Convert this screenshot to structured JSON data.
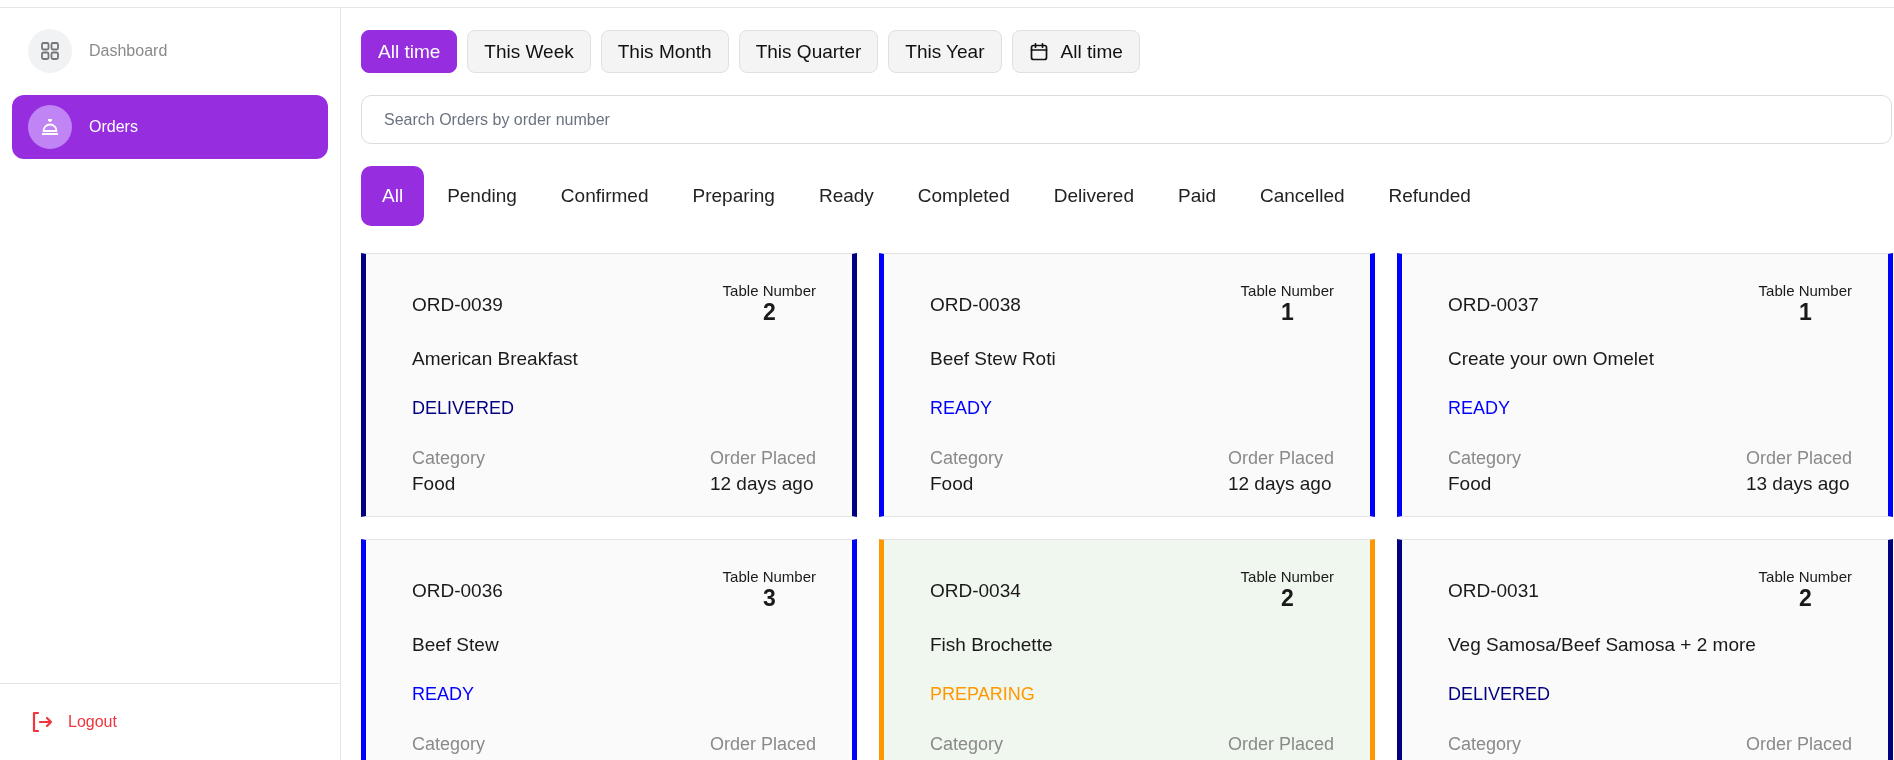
{
  "sidebar": {
    "items": [
      {
        "label": "Dashboard",
        "kind": "grid",
        "selected": false
      },
      {
        "label": "Orders",
        "kind": "cloche",
        "selected": true
      }
    ],
    "logout": "Logout"
  },
  "time_filters": [
    {
      "label": "All time",
      "selected": true,
      "kind": "preset"
    },
    {
      "label": "This Week",
      "selected": false,
      "kind": "preset"
    },
    {
      "label": "This Month",
      "selected": false,
      "kind": "preset"
    },
    {
      "label": "This Quarter",
      "selected": false,
      "kind": "preset"
    },
    {
      "label": "This Year",
      "selected": false,
      "kind": "preset"
    },
    {
      "label": "All time",
      "selected": false,
      "kind": "date"
    }
  ],
  "search": {
    "placeholder": "Search Orders by order number"
  },
  "status_tabs": [
    {
      "label": "All",
      "selected": true
    },
    {
      "label": "Pending",
      "selected": false
    },
    {
      "label": "Confirmed",
      "selected": false
    },
    {
      "label": "Preparing",
      "selected": false
    },
    {
      "label": "Ready",
      "selected": false
    },
    {
      "label": "Completed",
      "selected": false
    },
    {
      "label": "Delivered",
      "selected": false
    },
    {
      "label": "Paid",
      "selected": false
    },
    {
      "label": "Cancelled",
      "selected": false
    },
    {
      "label": "Refunded",
      "selected": false
    }
  ],
  "orders": [
    {
      "number": "ORD-0039",
      "table_label": "Table Number",
      "table": "2",
      "items": "American Breakfast",
      "status": "DELIVERED",
      "color": "#000080",
      "highlighted": false,
      "category_label": "Category",
      "category": "Food",
      "placed_label": "Order Placed",
      "placed": "12 days ago"
    },
    {
      "number": "ORD-0038",
      "table_label": "Table Number",
      "table": "1",
      "items": "Beef Stew Roti",
      "status": "READY",
      "color": "#0000ff",
      "highlighted": false,
      "category_label": "Category",
      "category": "Food",
      "placed_label": "Order Placed",
      "placed": "12 days ago"
    },
    {
      "number": "ORD-0037",
      "table_label": "Table Number",
      "table": "1",
      "items": "Create your own Omelet",
      "status": "READY",
      "color": "#0000ff",
      "highlighted": false,
      "category_label": "Category",
      "category": "Food",
      "placed_label": "Order Placed",
      "placed": "13 days ago"
    },
    {
      "number": "ORD-0036",
      "table_label": "Table Number",
      "table": "3",
      "items": "Beef Stew",
      "status": "READY",
      "color": "#0000ff",
      "highlighted": false,
      "category_label": "Category",
      "placed_label": "Order Placed"
    },
    {
      "number": "ORD-0034",
      "table_label": "Table Number",
      "table": "2",
      "items": "Fish Brochette",
      "status": "PREPARING",
      "color": "#ff9800",
      "highlighted": true,
      "category_label": "Category",
      "placed_label": "Order Placed"
    },
    {
      "number": "ORD-0031",
      "table_label": "Table Number",
      "table": "2",
      "items": "Veg Samosa/Beef Samosa + 2 more",
      "status": "DELIVERED",
      "color": "#000080",
      "highlighted": false,
      "category_label": "Category",
      "placed_label": "Order Placed"
    }
  ]
}
